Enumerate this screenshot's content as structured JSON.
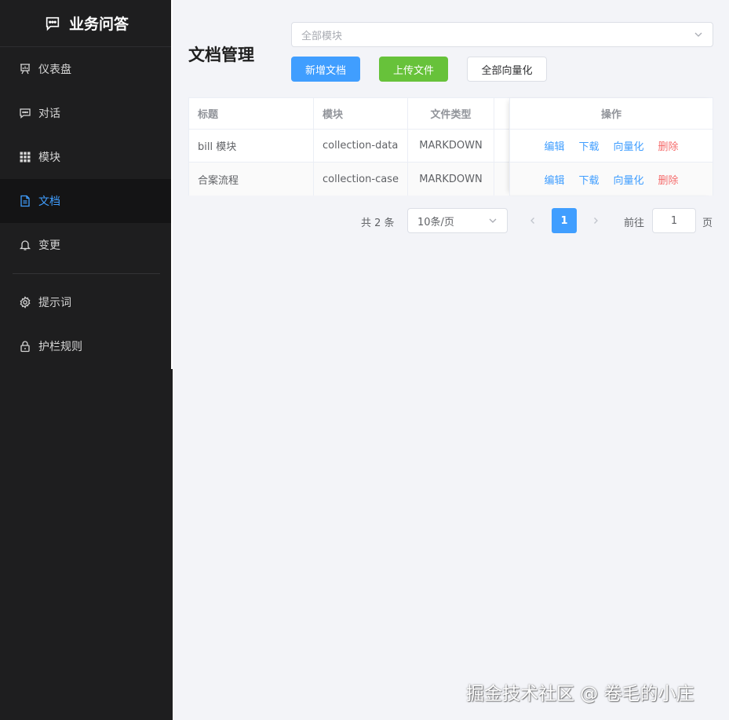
{
  "app": {
    "brand": "业务问答",
    "brand_icon": "chat-icon"
  },
  "sidebar": {
    "items": [
      {
        "label": "仪表盘",
        "icon": "dashboard-icon",
        "active": false
      },
      {
        "label": "对话",
        "icon": "chat-icon",
        "active": false
      },
      {
        "label": "模块",
        "icon": "grid-icon",
        "active": false
      },
      {
        "label": "文档",
        "icon": "document-icon",
        "active": true
      },
      {
        "label": "变更",
        "icon": "bell-icon",
        "active": false
      },
      {
        "label": "提示词",
        "icon": "gear-icon",
        "active": false
      },
      {
        "label": "护栏规则",
        "icon": "lock-icon",
        "active": false
      }
    ]
  },
  "main": {
    "title": "文档管理",
    "module_filter": {
      "placeholder": "全部模块"
    },
    "buttons": {
      "add": "新增文档",
      "upload": "上传文件",
      "vectorize_all": "全部向量化"
    }
  },
  "table": {
    "columns": [
      "标题",
      "模块",
      "文件类型",
      "操作"
    ],
    "rows": [
      {
        "title": "bill 模块",
        "module": "collection-data",
        "type": "MARKDOWN"
      },
      {
        "title": "合案流程",
        "module": "collection-case",
        "type": "MARKDOWN"
      }
    ],
    "actions": {
      "edit": "编辑",
      "download": "下载",
      "vectorize": "向量化",
      "delete": "删除"
    }
  },
  "pagination": {
    "total": "共 2 条",
    "page_size": "10条/页",
    "current": "1",
    "goto_label": "前往",
    "goto_value": "1",
    "page_suffix": "页"
  },
  "watermark": "掘金技术社区 @ 卷毛的小庄",
  "colors": {
    "sidebar_bg": "#1e1e1f",
    "accent": "#409eff",
    "success": "#67c23a",
    "danger": "#f56c6c"
  }
}
